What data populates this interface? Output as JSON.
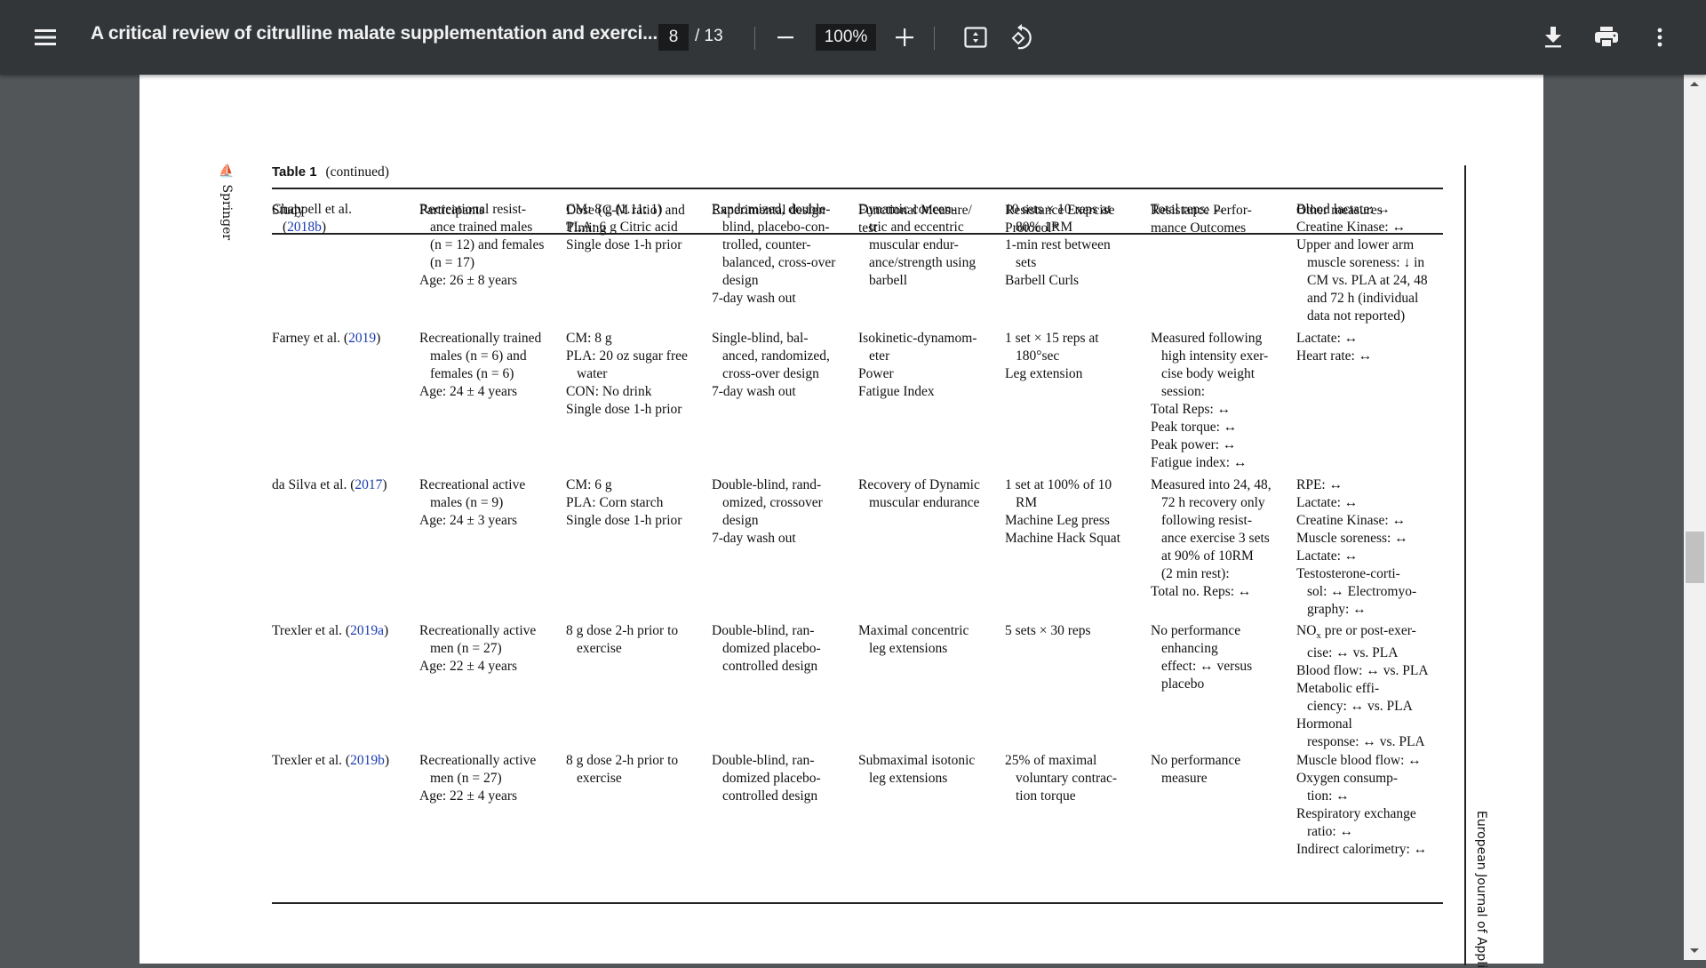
{
  "toolbar": {
    "menu_icon": "hamburger-menu-icon",
    "title": "A critical review of citrulline malate supplementation and exerci...",
    "current_page": "8",
    "total_pages": "/ 13",
    "zoom_level": "100%",
    "icons": {
      "zoom_out": "minus-icon",
      "zoom_in": "plus-icon",
      "fit": "fit-to-page-icon",
      "rotate": "rotate-counterclockwise-icon",
      "download": "download-icon",
      "print": "print-icon",
      "more": "more-vert-icon"
    }
  },
  "document": {
    "side_label_left": "Springer",
    "side_label_right": "European Journal of Appli",
    "table_caption_bold": "Table 1",
    "table_caption_rest": "(continued)",
    "headers": [
      [
        "Study"
      ],
      [
        "Participants"
      ],
      [
        "Dose (C-M ratio) and",
        "Timing"
      ],
      [
        "Experimental design"
      ],
      [
        "Functional Measure/",
        "test"
      ],
      [
        "Resistance Exercise",
        "Protocol*"
      ],
      [
        "Resistance Perfor-",
        "mance Outcomes"
      ],
      [
        "Other measures"
      ]
    ],
    "rows": [
      {
        "study": [
          "Chappell et al.",
          "(2018b)"
        ],
        "participants": [
          "Recreational resist-",
          "ance trained males",
          "(n = 12) and females",
          "(n = 17)",
          "Age: 26 ± 8 years"
        ],
        "dose": [
          "CM: 8 g (1.11: 1)",
          "PLA: 6 g Citric acid",
          "Single dose 1-h prior"
        ],
        "design": [
          "Randomized, double-",
          "blind, placebo-con-",
          "trolled, counter-",
          "balanced, cross-over",
          "design",
          "7-day wash out"
        ],
        "functional": [
          "Dynamic concen-",
          "tric and eccentric",
          "muscular endur-",
          "ance/strength using",
          "barbell"
        ],
        "protocol": [
          "10 sets × 10 reps at",
          "80% 1RM",
          "1-min rest between",
          "sets",
          "Barbell Curls"
        ],
        "outcomes": [
          "Total reps: ↔"
        ],
        "other": [
          "Blood lactate: ↔",
          "Creatine Kinase: ↔",
          "Upper and lower arm",
          "muscle soreness: ↓ in",
          "CM vs. PLA at 24, 48",
          "and 72 h (individual",
          "data not reported)"
        ]
      },
      {
        "study": [
          "Farney et al. (2019)"
        ],
        "participants": [
          "Recreationally trained",
          "males (n = 6) and",
          "females (n = 6)",
          "Age: 24 ± 4 years"
        ],
        "dose": [
          "CM: 8 g",
          "PLA: 20 oz sugar free",
          "water",
          "CON: No drink",
          "Single dose 1-h prior"
        ],
        "design": [
          "Single-blind, bal-",
          "anced, randomized,",
          "cross-over design",
          "7-day wash out"
        ],
        "functional": [
          "Isokinetic-dynamom-",
          "eter",
          "Power",
          "Fatigue Index"
        ],
        "protocol": [
          "1 set × 15 reps at",
          "180°sec",
          "Leg extension"
        ],
        "outcomes": [
          "Measured following",
          "high intensity exer-",
          "cise body weight",
          "session:",
          "Total Reps: ↔",
          "Peak torque: ↔",
          "Peak power: ↔",
          "Fatigue index: ↔"
        ],
        "other": [
          "Lactate: ↔",
          "Heart rate: ↔"
        ]
      },
      {
        "study": [
          "da Silva et al. (2017)"
        ],
        "participants": [
          "Recreational active",
          "males (n = 9)",
          "Age: 24 ± 3 years"
        ],
        "dose": [
          "CM: 6 g",
          "PLA: Corn starch",
          "Single dose 1-h prior"
        ],
        "design": [
          "Double-blind, rand-",
          "omized, crossover",
          "design",
          "7-day wash out"
        ],
        "functional": [
          "Recovery of Dynamic",
          "muscular endurance"
        ],
        "protocol": [
          "1 set at 100% of 10",
          "RM",
          "Machine Leg press",
          "Machine Hack Squat"
        ],
        "outcomes": [
          "Measured into 24, 48,",
          "72 h recovery only",
          "following resist-",
          "ance exercise 3 sets",
          "at 90% of 10RM",
          "(2 min rest):",
          "Total no. Reps: ↔"
        ],
        "other": [
          "RPE: ↔",
          "Lactate: ↔",
          "Creatine Kinase: ↔",
          "Muscle soreness: ↔",
          "Lactate: ↔",
          "Testosterone-corti-",
          "sol: ↔ Electromyo-",
          "graphy: ↔"
        ]
      },
      {
        "study": [
          "Trexler et al. (2019a)"
        ],
        "participants": [
          "Recreationally active",
          "men (n = 27)",
          "Age: 22 ± 4 years"
        ],
        "dose": [
          "8 g dose 2-h prior to",
          "exercise"
        ],
        "design": [
          "Double-blind, ran-",
          "domized placebo-",
          "controlled design"
        ],
        "functional": [
          "Maximal concentric",
          "leg extensions"
        ],
        "protocol": [
          "5 sets × 30 reps"
        ],
        "outcomes": [
          "No performance",
          "enhancing",
          "effect: ↔ versus",
          "placebo"
        ],
        "other": [
          "NOx pre or post-exer-",
          "cise: ↔ vs. PLA",
          "Blood flow: ↔ vs. PLA",
          "Metabolic effi-",
          "ciency: ↔ vs. PLA",
          "Hormonal",
          "response: ↔ vs. PLA"
        ]
      },
      {
        "study": [
          "Trexler et al. (2019b)"
        ],
        "participants": [
          "Recreationally active",
          "men (n = 27)",
          "Age: 22 ± 4 years"
        ],
        "dose": [
          "8 g dose 2-h prior to",
          "exercise"
        ],
        "design": [
          "Double-blind, ran-",
          "domized placebo-",
          "controlled design"
        ],
        "functional": [
          "Submaximal isotonic",
          "leg extensions"
        ],
        "protocol": [
          "25% of maximal",
          "voluntary contrac-",
          "tion torque"
        ],
        "outcomes": [
          "No performance",
          "measure"
        ],
        "other": [
          "Muscle blood flow: ↔",
          "Oxygen consump-",
          "tion: ↔",
          "Respiratory exchange",
          "ratio: ↔",
          "Indirect calorimetry: ↔"
        ]
      }
    ],
    "citation_color": "#1a3cb0"
  },
  "scrollbar": {
    "position_fraction": 0.55
  }
}
